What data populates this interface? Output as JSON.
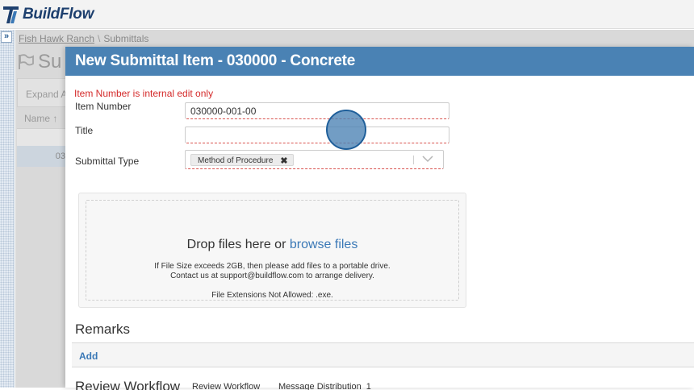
{
  "app": {
    "logo_text": "BuildFlow"
  },
  "colors": {
    "modal_header": "#4a82b4",
    "error": "#d42a2a",
    "link": "#3a78b6"
  },
  "background_page": {
    "breadcrumb": {
      "project": "Fish Hawk Ranch",
      "separator": "\\",
      "current": "Submittals"
    },
    "title_partial": "Su",
    "toolbar_partial": "Expand A",
    "column_header_partial": "Name ↑",
    "row_partial": "03"
  },
  "modal": {
    "title": "New Submittal Item - 030000 - Concrete",
    "notice": "Item Number is internal edit only",
    "fields": {
      "item_number": {
        "label": "Item Number",
        "value": "030000-001-00"
      },
      "title": {
        "label": "Title",
        "value": ""
      },
      "submittal_type": {
        "label": "Submittal Type",
        "selected": "Method of Procedure",
        "remove_symbol": "✖"
      }
    },
    "dropzone": {
      "prefix": "Drop files here or ",
      "link": "browse files",
      "line1": "If File Size exceeds 2GB, then please add files to a portable drive.",
      "line2": "Contact us at support@buildflow.com to arrange delivery.",
      "line3": "File Extensions Not Allowed: .exe."
    },
    "remarks": {
      "title": "Remarks",
      "add_label": "Add"
    },
    "review": {
      "title": "Review Workflow",
      "tab_workflow": "Review Workflow",
      "tab_distribution": "Message Distribution",
      "distribution_count": "1"
    }
  },
  "icons": {
    "rail_expand": "double-chevron-right-icon",
    "flag": "flag-icon",
    "dropdown": "chevron-down-icon"
  }
}
